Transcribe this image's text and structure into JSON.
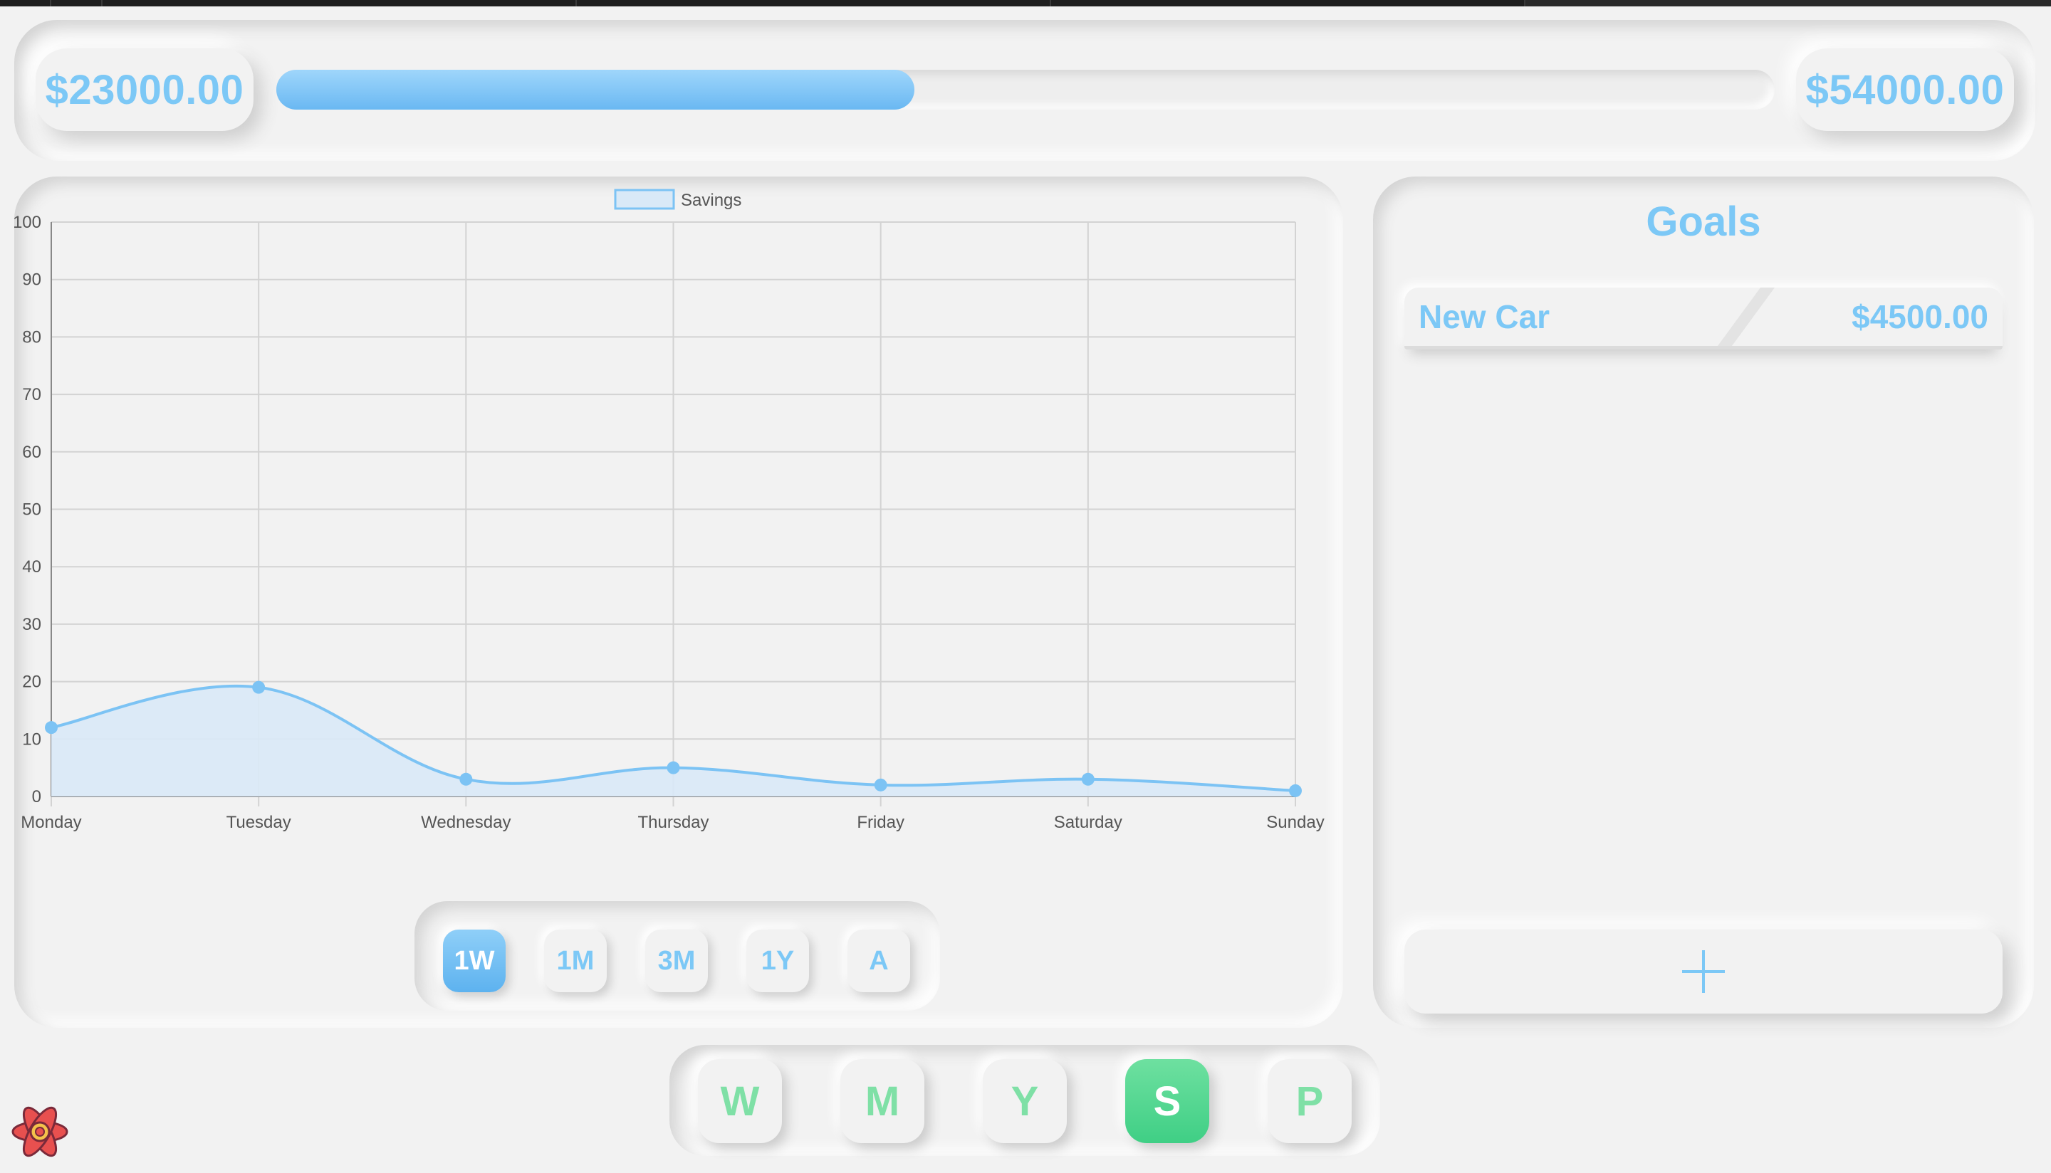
{
  "progress": {
    "current_label": "$23000.00",
    "target_label": "$54000.00",
    "fill_fraction": 0.426
  },
  "chart_data": {
    "type": "line",
    "categories": [
      "Monday",
      "Tuesday",
      "Wednesday",
      "Thursday",
      "Friday",
      "Saturday",
      "Sunday"
    ],
    "series": [
      {
        "name": "Savings",
        "values": [
          12,
          19,
          3,
          5,
          2,
          3,
          1
        ]
      }
    ],
    "ylim": [
      0,
      100
    ],
    "yticks": [
      0,
      10,
      20,
      30,
      40,
      50,
      60,
      70,
      80,
      90,
      100
    ],
    "grid": true,
    "legend": "top-center",
    "fill": true,
    "colors": {
      "line": "#7cc3f4",
      "area": "#d9e9f7",
      "grid": "#d3d3d3",
      "text": "#555555"
    }
  },
  "range_buttons": [
    {
      "label": "1W",
      "active": true
    },
    {
      "label": "1M",
      "active": false
    },
    {
      "label": "3M",
      "active": false
    },
    {
      "label": "1Y",
      "active": false
    },
    {
      "label": "A",
      "active": false
    }
  ],
  "goals": {
    "title": "Goals",
    "items": [
      {
        "name": "New Car",
        "amount": "$4500.00"
      }
    ],
    "add_icon": "plus-icon"
  },
  "nav": [
    {
      "label": "W",
      "active": false
    },
    {
      "label": "M",
      "active": false
    },
    {
      "label": "Y",
      "active": false
    },
    {
      "label": "S",
      "active": true
    },
    {
      "label": "P",
      "active": false
    }
  ],
  "logo_icon": "react-logo-icon",
  "colors": {
    "accent_blue": "#7cc8f6",
    "accent_green": "#7fe0a6",
    "background": "#f2f2f2"
  }
}
